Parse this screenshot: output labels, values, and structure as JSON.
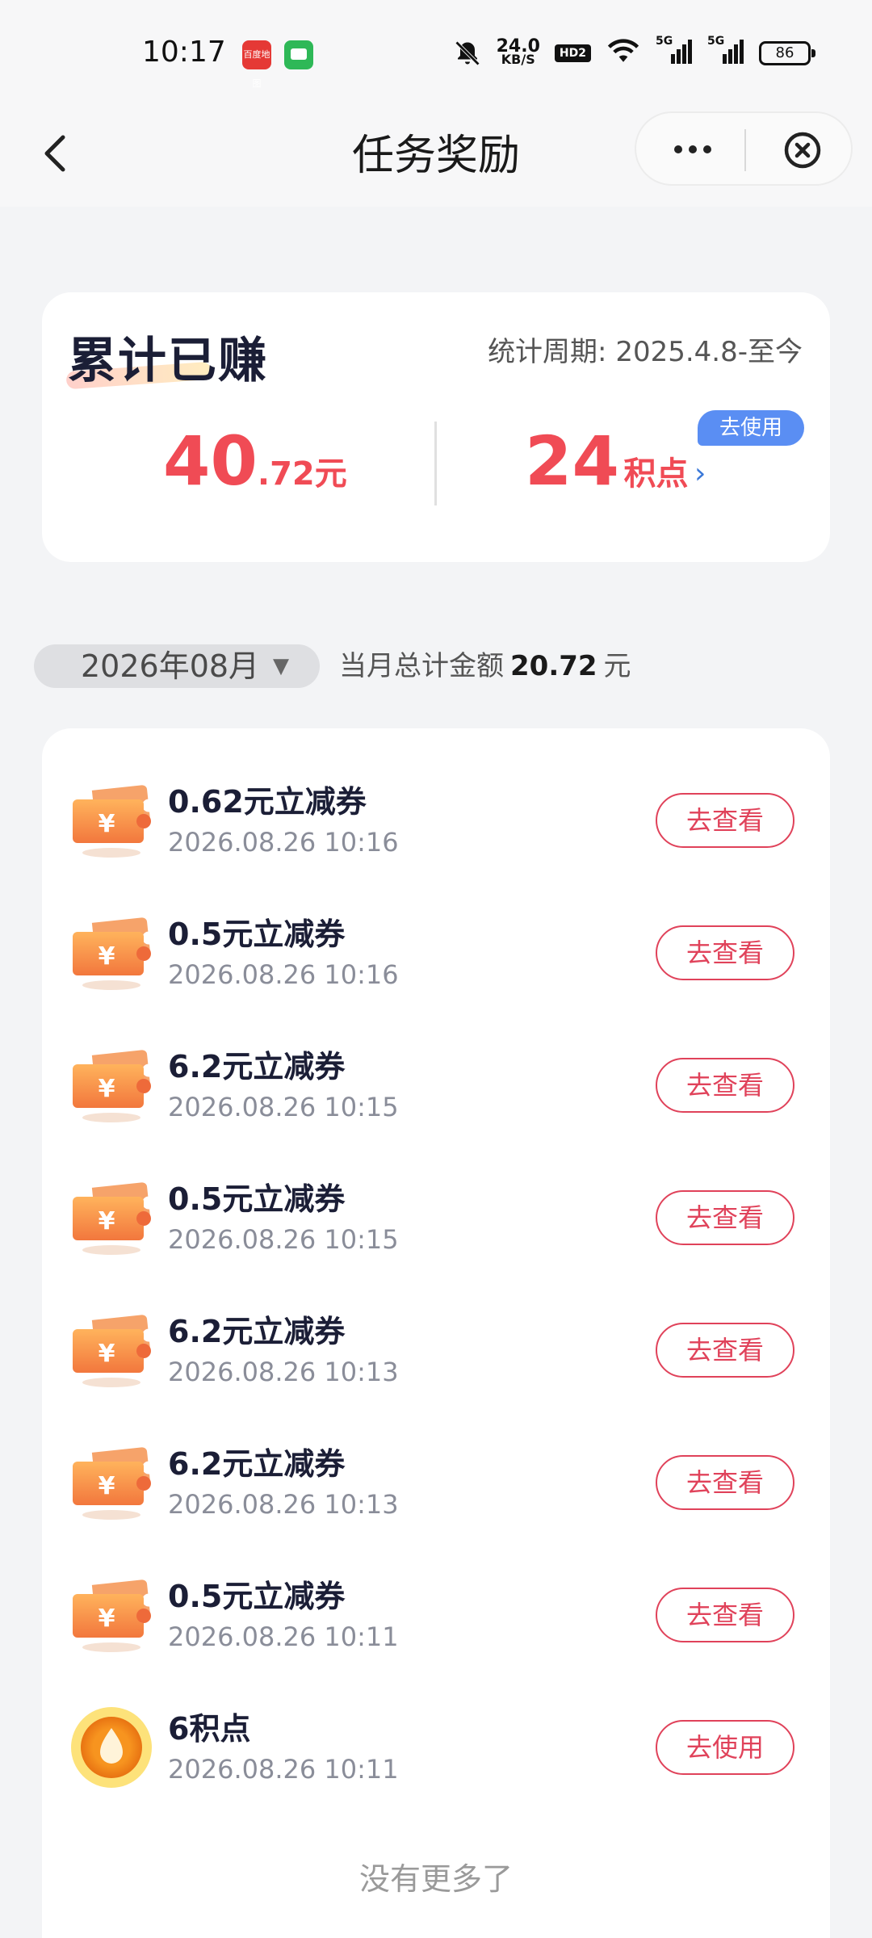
{
  "status": {
    "time": "10:17",
    "net_speed_value": "24.0",
    "net_speed_unit": "KB/S",
    "hd_label": "HD2",
    "sig1_label": "5G",
    "sig2_label": "5G",
    "battery": "86",
    "app1_label": "百度地图"
  },
  "nav": {
    "title": "任务奖励"
  },
  "summary": {
    "title": "累计已赚",
    "period": "统计周期: 2025.4.8-至今",
    "money_int": "40",
    "money_dec": ".72",
    "money_unit": "元",
    "points_int": "24",
    "points_unit": "积点",
    "arrow": "›",
    "use_badge": "去使用"
  },
  "filter": {
    "month": "2026年08月",
    "caret": "▼",
    "total_label": "当月总计金额",
    "total_amount": "20.72",
    "total_unit": "元"
  },
  "rewards": [
    {
      "title": "0.62元立减券",
      "time": "2026.08.26 10:16",
      "action": "去查看",
      "icon": "coupon-icon"
    },
    {
      "title": "0.5元立减券",
      "time": "2026.08.26 10:16",
      "action": "去查看",
      "icon": "coupon-icon"
    },
    {
      "title": "6.2元立减券",
      "time": "2026.08.26 10:15",
      "action": "去查看",
      "icon": "coupon-icon"
    },
    {
      "title": "0.5元立减券",
      "time": "2026.08.26 10:15",
      "action": "去查看",
      "icon": "coupon-icon"
    },
    {
      "title": "6.2元立减券",
      "time": "2026.08.26 10:13",
      "action": "去查看",
      "icon": "coupon-icon"
    },
    {
      "title": "6.2元立减券",
      "time": "2026.08.26 10:13",
      "action": "去查看",
      "icon": "coupon-icon"
    },
    {
      "title": "0.5元立减券",
      "time": "2026.08.26 10:11",
      "action": "去查看",
      "icon": "coupon-icon"
    },
    {
      "title": "6积点",
      "time": "2026.08.26 10:11",
      "action": "去使用",
      "icon": "points-coin-icon"
    }
  ],
  "list_end": "没有更多了",
  "colors": {
    "accent_red": "#f04b55",
    "button_red": "#e0425a",
    "badge_blue": "#5a8ef3",
    "coupon_orange": "#f7894a",
    "coin_gold": "#f8c233"
  }
}
